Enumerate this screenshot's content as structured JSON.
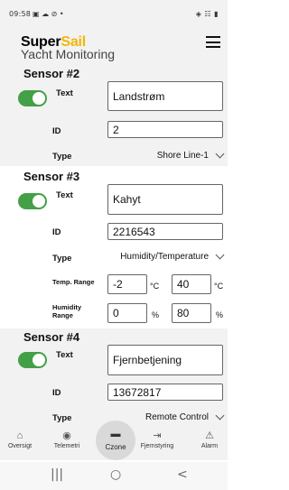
{
  "status_bar": {
    "time": "09:58",
    "left_icons": "▣ ☁ ⊘ •",
    "right_icons": "◈ ☷ ▮"
  },
  "header": {
    "brand_main": "Super",
    "brand_accent": "Sail",
    "subtitle": "Yacht Monitoring",
    "menu_icon": "hamburger-menu-icon"
  },
  "sensors": [
    {
      "title": "Sensor #2",
      "enabled": true,
      "text_label": "Text",
      "text_value": "Landstrøm",
      "id_label": "ID",
      "id_value": "2",
      "type_label": "Type",
      "type_value": "Shore Line-1"
    },
    {
      "title": "Sensor #3",
      "enabled": true,
      "text_label": "Text",
      "text_value": "Kahyt",
      "id_label": "ID",
      "id_value": "2216543",
      "type_label": "Type",
      "type_value": "Humidity/Temperature",
      "temp_range_label": "Temp. Range",
      "temp_min": "-2",
      "temp_max": "40",
      "temp_unit": "°C",
      "humidity_range_label_1": "Humidity",
      "humidity_range_label_2": "Range",
      "hum_min": "0",
      "hum_max": "80",
      "hum_unit": "%"
    },
    {
      "title": "Sensor #4",
      "enabled": true,
      "text_label": "Text",
      "text_value": "Fjernbetjening",
      "id_label": "ID",
      "id_value": "13672817",
      "type_label": "Type",
      "type_value": "Remote Control"
    }
  ],
  "bottom_nav": [
    {
      "label": "Oversigt",
      "icon": "home-icon",
      "glyph": "⌂"
    },
    {
      "label": "Telemetri",
      "icon": "eye-icon",
      "glyph": "◉"
    },
    {
      "label": "Czone",
      "icon": "switch-icon",
      "glyph": "▬",
      "active": true
    },
    {
      "label": "Fjernstyring",
      "icon": "remote-icon",
      "glyph": "⇥"
    },
    {
      "label": "Alarm",
      "icon": "alarm-icon",
      "glyph": "⚠"
    }
  ],
  "android_nav": {
    "recents": "|||",
    "home": "○",
    "back": "<"
  },
  "colors": {
    "accent": "#f2b705",
    "toggle_on": "#43a047",
    "section_gray": "#f2f2f2"
  }
}
